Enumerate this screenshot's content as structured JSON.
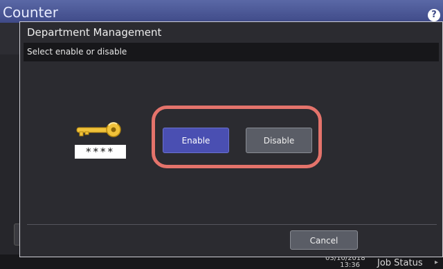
{
  "header": {
    "title": "Counter",
    "help_glyph": "?"
  },
  "dialog": {
    "title": "Department Management",
    "instruction": "Select enable or disable",
    "password_mask": "****",
    "enable_label": "Enable",
    "disable_label": "Disable",
    "cancel_label": "Cancel"
  },
  "status": {
    "date": "03/10/2018",
    "time": "13:36",
    "job_status_label": "Job Status"
  },
  "colors": {
    "header": "#4a57a0",
    "dialog_bg": "#2b2b30",
    "primary_button": "#4a4fb2",
    "secondary_button": "#5a5d66",
    "highlight": "#e4736b",
    "key": "#f0c23a"
  },
  "icons": [
    "help-icon",
    "key-icon",
    "chevron-right-icon"
  ]
}
